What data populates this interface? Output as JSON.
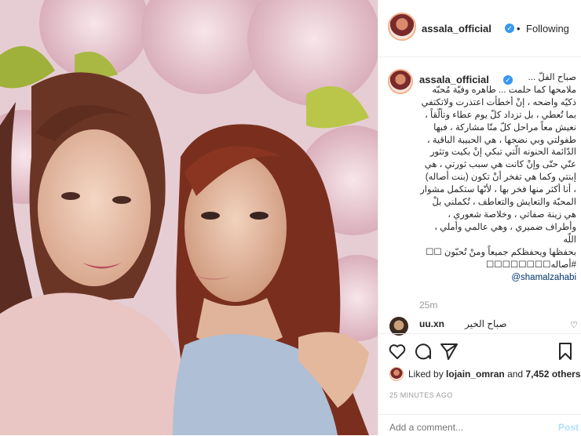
{
  "post": {
    "username": "assala_official",
    "follow_label": "Following",
    "caption_user": "assala_official",
    "caption_text": "صباح الفلّ ...\nملامحها كما حلمت ... طاهره وفيّة مُحبّه\nذكيّه واضحه ، إنْ أخطأت اعتذرت ولاتكتفي\nبما تُعطي ، بل تزداد كلّ يوم عطاء وتألّقاً ،\nنعيش معاً مراحل كلّ منّا مشاركة ، فبها\nطفولتي وبي نضجها ، هي الحبيبة الباقية ،\nالدّائمة الحنونه الّتي تبكي إنْ بكيت وتثور\nعنّي حتّى وإنْ كانت هي سبب ثورتي ، هي\nإبنتي وكما هي تفخر أنْ تكون (بنت أصاله)\n، أنا أكثر منها فخر بها ، لأنّها ستكمل مشوار\nالمحبّة والتعايش والتعاطف ، تُكملني بلْ\nهي زينة صفاتي ، وخلاصة شعوري ،\nوأطراف ضميري ، وهي عالمي وأملي ، اللّه\nبحفظها ويحفظكم جميعاً ومنْ تُحبّون ☐☐\n#أصاله☐☐☐☐☐☐☐☐",
    "mention": "@shamalzahabi",
    "time_ago": "25m",
    "comment": {
      "username": "uu.xn",
      "text": "صباح الخير"
    },
    "likes": {
      "prefix": "Liked by",
      "user": "lojain_omran",
      "middle": "and",
      "count": "7,452 others"
    },
    "timestamp": "25 MINUTES AGO",
    "add_comment_placeholder": "Add a comment...",
    "post_label": "Post"
  },
  "colors": {
    "verified": "#3897f0",
    "link": "#003569",
    "muted": "#999999",
    "post_disabled": "#b2dffc"
  },
  "icons": [
    "heart-icon",
    "comment-icon",
    "share-icon",
    "bookmark-icon",
    "verified-icon"
  ]
}
